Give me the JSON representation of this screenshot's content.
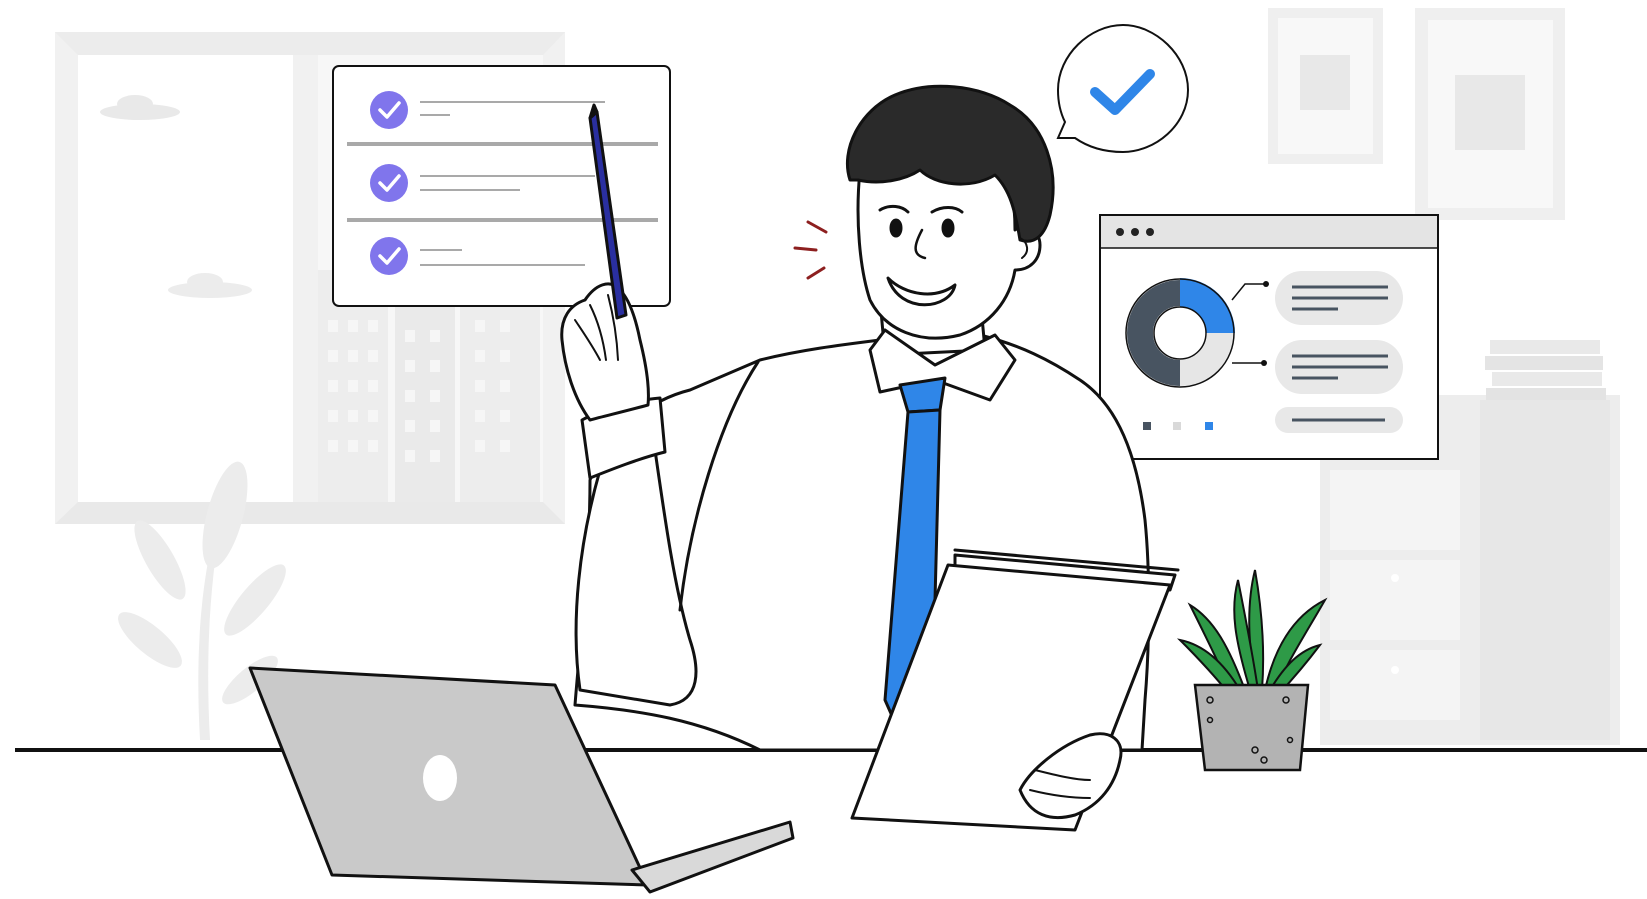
{
  "colors": {
    "accent_blue": "#2f86e8",
    "check_purple": "#8075ec",
    "chart_dark": "#485461",
    "chart_light": "#e6e6e6",
    "leaf_green": "#2e9a47",
    "pot_grey": "#b3b3b3",
    "laptop_grey": "#c9c9c9",
    "bg_grey": "#f1f1f1",
    "line": "#111111",
    "exclaim_red": "#8d1f1f"
  },
  "checklist": {
    "items": [
      {
        "state": "checked",
        "icon": "check-circle-icon"
      },
      {
        "state": "checked",
        "icon": "check-circle-icon"
      },
      {
        "state": "checked",
        "icon": "check-circle-icon"
      }
    ]
  },
  "speech_bubble": {
    "icon": "checkmark-icon"
  },
  "dashboard": {
    "window_dots": 3,
    "donut_icon": "donut-chart-icon",
    "legend_swatches": [
      "#485461",
      "#d9d9d9",
      "#2f86e8"
    ]
  },
  "scene": {
    "person": "businessman-with-pen-and-document",
    "laptop": "laptop-icon",
    "plant": "potted-plant-icon"
  }
}
